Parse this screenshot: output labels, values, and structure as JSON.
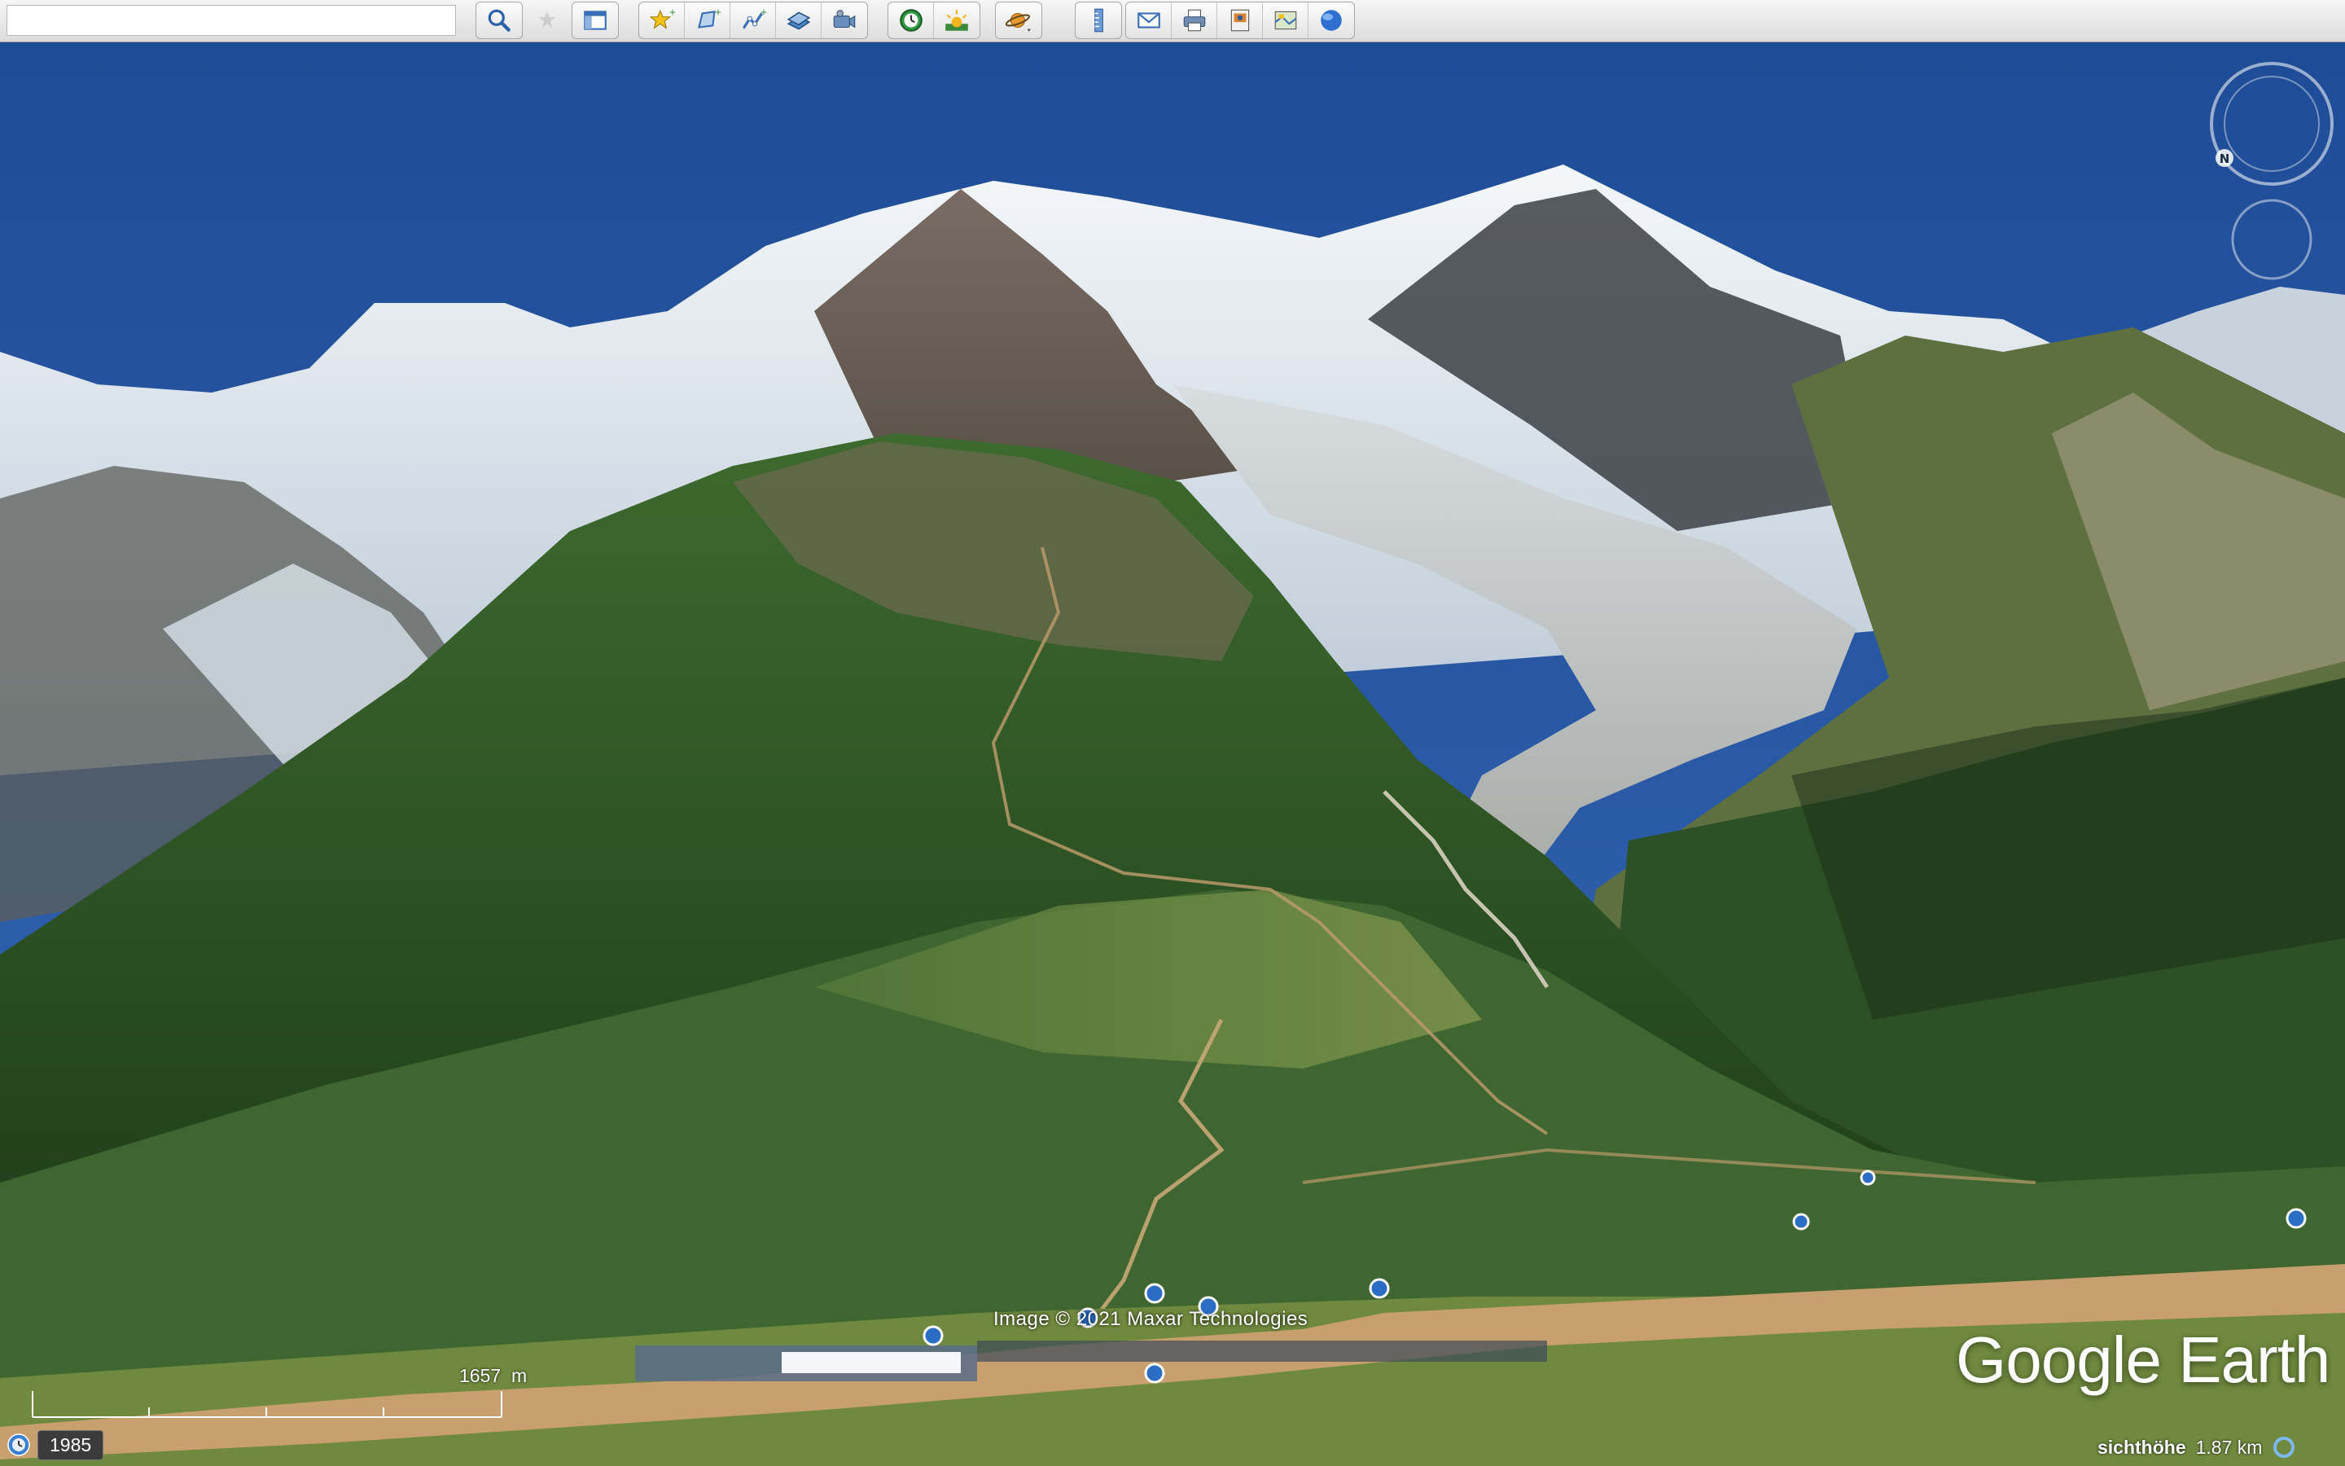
{
  "toolbar": {
    "search_value": "",
    "buttons": [
      {
        "icon": "search-icon"
      },
      {
        "icon": "sidebar-toggle-icon"
      },
      {
        "icon": "add-placemark-icon"
      },
      {
        "icon": "add-polygon-icon"
      },
      {
        "icon": "add-path-icon"
      },
      {
        "icon": "add-image-overlay-icon"
      },
      {
        "icon": "record-tour-icon"
      },
      {
        "icon": "historical-imagery-icon"
      },
      {
        "icon": "sunlight-icon"
      },
      {
        "icon": "planets-icon"
      },
      {
        "icon": "ruler-icon"
      },
      {
        "icon": "email-icon"
      },
      {
        "icon": "print-icon"
      },
      {
        "icon": "save-image-icon"
      },
      {
        "icon": "view-in-maps-icon"
      },
      {
        "icon": "earth-gallery-icon"
      }
    ]
  },
  "navigation": {
    "compass_label": "N"
  },
  "map": {
    "credit": "Image © 2021 Maxar Technologies",
    "brand": "Google Earth",
    "scale_value": "1657",
    "scale_unit": "m",
    "year": "1985",
    "altitude_label": "sichthöhe",
    "altitude_value": "1.87 km"
  },
  "colors": {
    "sky": "#2c55a0",
    "forest": "#2d5228",
    "snow": "#e8eef2",
    "toolbar_bg": "#e8e8e8"
  }
}
